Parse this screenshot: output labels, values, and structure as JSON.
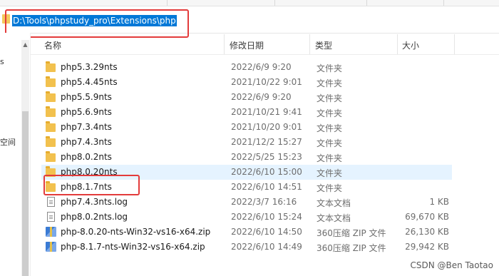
{
  "address": {
    "path": "D:\\Tools\\phpstudy_pro\\Extensions\\php"
  },
  "nav": {
    "fragments": [
      "s",
      "空间"
    ]
  },
  "columns": {
    "name": "名称",
    "modified": "修改日期",
    "type": "类型",
    "size": "大小"
  },
  "files": [
    {
      "name": "php5.3.29nts",
      "date": "2022/6/9 9:20",
      "type": "文件夹",
      "size": "",
      "icon": "folder-icon"
    },
    {
      "name": "php5.4.45nts",
      "date": "2021/10/22 9:01",
      "type": "文件夹",
      "size": "",
      "icon": "folder-icon"
    },
    {
      "name": "php5.5.9nts",
      "date": "2022/6/9 9:20",
      "type": "文件夹",
      "size": "",
      "icon": "folder-icon"
    },
    {
      "name": "php5.6.9nts",
      "date": "2021/10/21 9:41",
      "type": "文件夹",
      "size": "",
      "icon": "folder-icon"
    },
    {
      "name": "php7.3.4nts",
      "date": "2021/10/20 9:01",
      "type": "文件夹",
      "size": "",
      "icon": "folder-icon"
    },
    {
      "name": "php7.4.3nts",
      "date": "2021/12/2 15:27",
      "type": "文件夹",
      "size": "",
      "icon": "folder-icon"
    },
    {
      "name": "php8.0.2nts",
      "date": "2022/5/25 15:23",
      "type": "文件夹",
      "size": "",
      "icon": "folder-icon"
    },
    {
      "name": "php8.0.20nts",
      "date": "2022/6/10 15:00",
      "type": "文件夹",
      "size": "",
      "icon": "folder-icon"
    },
    {
      "name": "php8.1.7nts",
      "date": "2022/6/10 14:51",
      "type": "文件夹",
      "size": "",
      "icon": "folder-icon"
    },
    {
      "name": "php7.4.3nts.log",
      "date": "2022/3/7 16:16",
      "type": "文本文档",
      "size": "1 KB",
      "icon": "log-file-icon"
    },
    {
      "name": "php8.0.2nts.log",
      "date": "2022/6/10 15:24",
      "type": "文本文档",
      "size": "69,670 KB",
      "icon": "log-file-icon"
    },
    {
      "name": "php-8.0.20-nts-Win32-vs16-x64.zip",
      "date": "2022/6/10 14:50",
      "type": "360压缩 ZIP 文件",
      "size": "26,130 KB",
      "icon": "zip-archive-icon"
    },
    {
      "name": "php-8.1.7-nts-Win32-vs16-x64.zip",
      "date": "2022/6/10 14:49",
      "type": "360压缩 ZIP 文件",
      "size": "29,942 KB",
      "icon": "zip-archive-icon"
    }
  ],
  "watermark": "CSDN @Ben Taotao",
  "colors": {
    "selection": "#0078d7",
    "highlight_box": "#e33b3b",
    "row_hover": "#e5f3ff",
    "folder": "#f2c14e"
  }
}
